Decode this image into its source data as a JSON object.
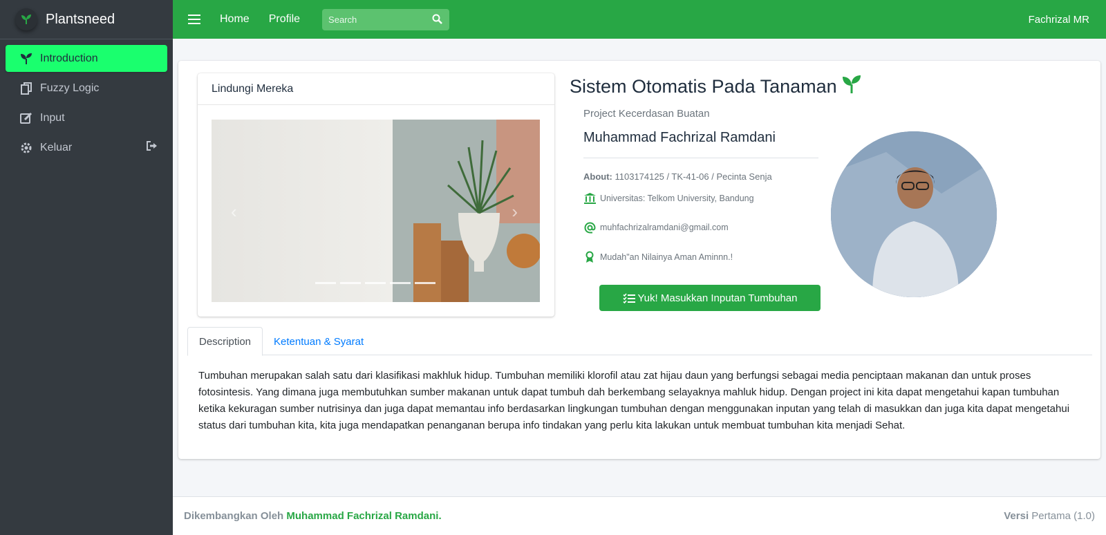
{
  "brand": {
    "name": "Plantsneed"
  },
  "sidebar": {
    "items": [
      {
        "label": "Introduction",
        "icon": "seedling-icon",
        "active": true
      },
      {
        "label": "Fuzzy Logic",
        "icon": "copy-icon"
      },
      {
        "label": "Input",
        "icon": "edit-icon"
      },
      {
        "label": "Keluar",
        "icon": "gear-icon",
        "right_icon": "sign-out-icon"
      }
    ]
  },
  "topbar": {
    "links": [
      "Home",
      "Profile"
    ],
    "search_placeholder": "Search",
    "user": "Fachrizal MR"
  },
  "card": {
    "header": "Lindungi Mereka",
    "carousel_slides": 5
  },
  "profile": {
    "title": "Sistem Otomatis Pada Tanaman",
    "subtitle": "Project Kecerdasan Buatan",
    "name": "Muhammad Fachrizal Ramdani",
    "about_label": "About:",
    "about_value": "1103174125 / TK-41-06 / Pecinta Senja",
    "university": "Universitas: Telkom University, Bandung",
    "email": "muhfachrizalramdani@gmail.com",
    "motto": "Mudah\"an Nilainya Aman Aminnn.!",
    "cta": "Yuk! Masukkan Inputan Tumbuhan"
  },
  "tabs": [
    "Description",
    "Ketentuan & Syarat"
  ],
  "description": "Tumbuhan merupakan salah satu dari klasifikasi makhluk hidup. Tumbuhan memiliki klorofil atau zat hijau daun yang berfungsi sebagai media penciptaan makanan dan untuk proses fotosintesis. Yang dimana juga membutuhkan sumber makanan untuk dapat tumbuh dah berkembang selayaknya mahluk hidup. Dengan project ini kita dapat mengetahui kapan tumbuhan ketika kekuragan sumber nutrisinya dan juga dapat memantau info berdasarkan lingkungan tumbuhan dengan menggunakan inputan yang telah di masukkan dan juga kita dapat mengetahui status dari tumbuhan kita, kita juga mendapatkan penanganan berupa info tindakan yang perlu kita lakukan untuk membuat tumbuhan kita menjadi Sehat.",
  "footer": {
    "prefix": "Dikembangkan Oleh",
    "author": "Muhammad Fachrizal Ramdani.",
    "version_label": "Versi",
    "version_value": "Pertama (1.0)"
  },
  "colors": {
    "primary": "#28a745",
    "sidebar": "#343a40",
    "active": "#1aff6e"
  }
}
